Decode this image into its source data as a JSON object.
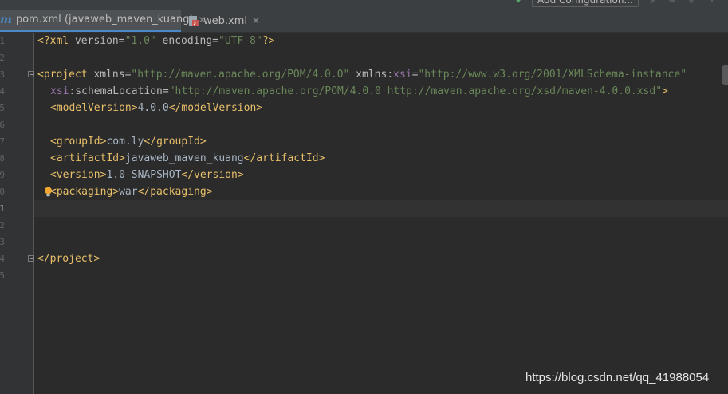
{
  "toolbar": {
    "run_config_label": "Add Configuration..."
  },
  "tabs": [
    {
      "label": "pom.xml (javaweb_maven_kuang)",
      "close": "✕",
      "active": true
    },
    {
      "label": "web.xml",
      "close": "✕",
      "active": false
    }
  ],
  "gutter": {
    "line_numbers": [
      "1",
      "2",
      "3",
      "4",
      "5",
      "6",
      "7",
      "8",
      "9",
      "10",
      "11",
      "12",
      "13",
      "14",
      "15"
    ],
    "current_line": "11"
  },
  "code": {
    "l1_decl": "<?xml ",
    "l1_a1": "version",
    "l1_eq1": "=",
    "l1_v1": "\"1.0\"",
    "l1_a2": " encoding",
    "l1_eq2": "=",
    "l1_v2": "\"UTF-8\"",
    "l1_end": "?>",
    "l3_open": "<project ",
    "l3_a1": "xmlns",
    "l3_eq1": "=",
    "l3_v1": "\"http://maven.apache.org/POM/4.0.0\"",
    "l3_a2": " xmlns:",
    "l3_ns": "xsi",
    "l3_eq2": "=",
    "l3_v2": "\"http://www.w3.org/2001/XMLSchema-instance\"",
    "l4_ns": "xsi",
    "l4_a": ":schemaLocation",
    "l4_eq": "=",
    "l4_v": "\"http://maven.apache.org/POM/4.0.0 http://maven.apache.org/xsd/maven-4.0.0.xsd\"",
    "l4_end": ">",
    "l5_open": "<modelVersion>",
    "l5_text": "4.0.0",
    "l5_close": "</modelVersion>",
    "l7_open": "<groupId>",
    "l7_text": "com.ly",
    "l7_close": "</groupId>",
    "l8_open": "<artifactId>",
    "l8_text": "javaweb_maven_kuang",
    "l8_close": "</artifactId>",
    "l9_open": "<version>",
    "l9_text": "1.0-SNAPSHOT",
    "l9_close": "</version>",
    "l10_open": "<packaging>",
    "l10_text": "war",
    "l10_close": "</packaging>",
    "l14_close": "</project>"
  },
  "watermark": "https://blog.csdn.net/qq_41988054",
  "colors": {
    "background": "#2b2b2b",
    "tag": "#e8bf6a",
    "attr_value": "#6a8759",
    "namespace": "#9876aa",
    "text": "#a9b7c6",
    "tab_underline": "#4a88c7"
  }
}
